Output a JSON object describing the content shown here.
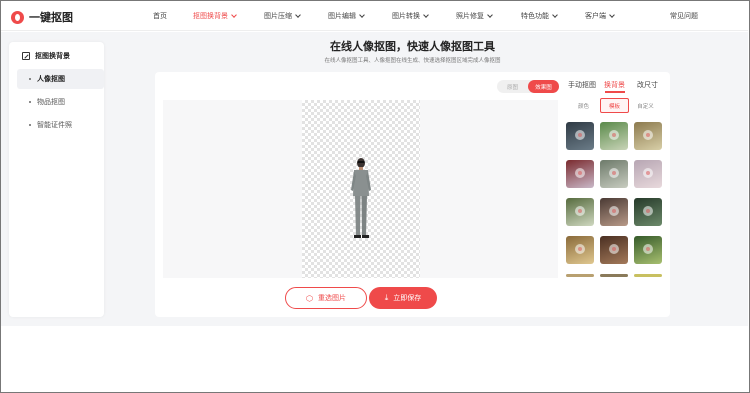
{
  "brand": {
    "name": "一键抠图",
    "accent": "#ef4a4a"
  },
  "nav": [
    {
      "label": "首页",
      "dropdown": false,
      "active": false
    },
    {
      "label": "抠图换背景",
      "dropdown": true,
      "active": true
    },
    {
      "label": "图片压缩",
      "dropdown": true,
      "active": false
    },
    {
      "label": "图片编辑",
      "dropdown": true,
      "active": false
    },
    {
      "label": "图片转换",
      "dropdown": true,
      "active": false
    },
    {
      "label": "照片修复",
      "dropdown": true,
      "active": false
    },
    {
      "label": "特色功能",
      "dropdown": true,
      "active": false
    },
    {
      "label": "客户端",
      "dropdown": true,
      "active": false
    },
    {
      "label": "常见问题",
      "dropdown": false,
      "active": false
    }
  ],
  "sidebar": {
    "title": "抠图换背景",
    "items": [
      {
        "label": "人像抠图",
        "active": true
      },
      {
        "label": "物品抠图",
        "active": false
      },
      {
        "label": "智能证件照",
        "active": false
      }
    ]
  },
  "main": {
    "title": "在线人像抠图，快速人像抠图工具",
    "subtitle": "在线人像抠图工具、人像抠图在线生成、快速选择抠图区域完成人像抠图"
  },
  "preview_toggle": {
    "original": "原图",
    "result": "效果图",
    "selected": "效果图"
  },
  "actions": {
    "reselect": "重选图片",
    "save": "立即保存"
  },
  "panel": {
    "tabs": [
      {
        "label": "手动抠图",
        "active": false
      },
      {
        "label": "换背景",
        "active": true
      },
      {
        "label": "改尺寸",
        "active": false
      }
    ],
    "segments": [
      {
        "label": "颜色",
        "active": false
      },
      {
        "label": "模板",
        "active": true
      },
      {
        "label": "自定义",
        "active": false
      }
    ],
    "thumbnails": [
      {
        "name": "dark-street",
        "colors": [
          "#2f3a44",
          "#6b7c88"
        ]
      },
      {
        "name": "green-road",
        "colors": [
          "#5a8a4a",
          "#c9d4b8"
        ]
      },
      {
        "name": "desert-road",
        "colors": [
          "#8c7a4e",
          "#d8cfa8"
        ]
      },
      {
        "name": "festival-lights",
        "colors": [
          "#7a2a2e",
          "#c9b8c8"
        ]
      },
      {
        "name": "misty-road",
        "colors": [
          "#6d7a6a",
          "#c8ccc0"
        ]
      },
      {
        "name": "pink-lights",
        "colors": [
          "#b7a6b3",
          "#e8d9dc"
        ]
      },
      {
        "name": "forest-path",
        "colors": [
          "#566b3e",
          "#cfd8c0"
        ]
      },
      {
        "name": "bokeh-portrait",
        "colors": [
          "#4a3a34",
          "#b89a88"
        ]
      },
      {
        "name": "pine-forest",
        "colors": [
          "#263a2a",
          "#6c8a6a"
        ]
      },
      {
        "name": "autumn-bokeh",
        "colors": [
          "#8a6a3a",
          "#e0c890"
        ]
      },
      {
        "name": "brown-bokeh",
        "colors": [
          "#4a2f22",
          "#a47a5a"
        ]
      },
      {
        "name": "green-bokeh",
        "colors": [
          "#355a2a",
          "#a8c070"
        ]
      }
    ]
  }
}
